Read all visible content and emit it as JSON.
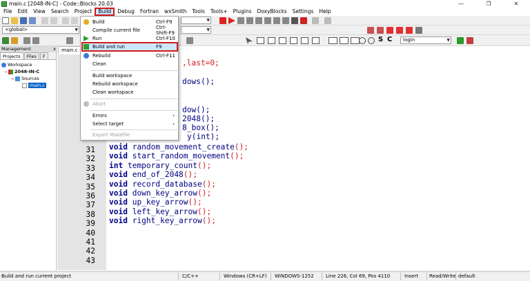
{
  "window": {
    "title": "main.c [2048-IN-C] - Code::Blocks 20.03",
    "minimize": "—",
    "maximize": "❐",
    "close": "✕"
  },
  "menubar": {
    "items": [
      "File",
      "Edit",
      "View",
      "Search",
      "Project",
      "Build",
      "Debug",
      "Fortran",
      "wxSmith",
      "Tools",
      "Tools+",
      "Plugins",
      "DoxyBlocks",
      "Settings",
      "Help"
    ],
    "active": "Build"
  },
  "toolbar": {
    "scope_combo": "<global>",
    "target_combo": "login"
  },
  "build_menu": {
    "items": [
      {
        "label": "Build",
        "shortcut": "Ctrl-F9",
        "icon": "gear-icon"
      },
      {
        "label": "Compile current file",
        "shortcut": "Ctrl-Shift-F9",
        "icon": ""
      },
      {
        "label": "Run",
        "shortcut": "Ctrl-F10",
        "icon": "play-icon"
      },
      {
        "label": "Build and run",
        "shortcut": "F9",
        "icon": "build-run-icon"
      },
      {
        "label": "Rebuild",
        "shortcut": "Ctrl-F11",
        "icon": "rebuild-icon"
      },
      {
        "label": "Clean",
        "shortcut": "",
        "icon": ""
      },
      {
        "label": "Build workspace",
        "shortcut": "",
        "icon": ""
      },
      {
        "label": "Rebuild workspace",
        "shortcut": "",
        "icon": ""
      },
      {
        "label": "Clean workspace",
        "shortcut": "",
        "icon": ""
      },
      {
        "label": "Abort",
        "shortcut": "",
        "icon": "abort-icon"
      },
      {
        "label": "Errors",
        "shortcut": "",
        "icon": ""
      },
      {
        "label": "Select target",
        "shortcut": "",
        "icon": ""
      },
      {
        "label": "Export Makefile",
        "shortcut": "",
        "icon": ""
      }
    ],
    "submenu_arrow": "›"
  },
  "management": {
    "header": "Management",
    "close": "x",
    "tabs": [
      "Projects",
      "Files",
      "F"
    ],
    "tree": {
      "workspace": "Workspace",
      "project": "2048-IN-C",
      "folder": "Sources",
      "file": "main.c"
    }
  },
  "editor": {
    "file_tab": "main.c",
    "visible_fragments": {
      "line_last": ",last=0;",
      "line_dows": "dows();",
      "line_dow": "dow();",
      "line_2048": "2048();",
      "line_8box": "8_box();",
      "line_yint": "y(int);"
    },
    "lines": [
      {
        "n": "31",
        "kw": "void",
        "name": "random_movement_create"
      },
      {
        "n": "32",
        "kw": "void",
        "name": "start_random_movement"
      },
      {
        "n": "33",
        "kw": "int",
        "name": "temporary_count"
      },
      {
        "n": "34",
        "kw": "void",
        "name": "end_of_2048"
      },
      {
        "n": "35",
        "kw": "void",
        "name": "record_database"
      },
      {
        "n": "36",
        "kw": "void",
        "name": "down_key_arrow"
      },
      {
        "n": "37",
        "kw": "void",
        "name": "up_key_arrow"
      },
      {
        "n": "38",
        "kw": "void",
        "name": "left_key_arrow"
      },
      {
        "n": "39",
        "kw": "void",
        "name": "right_key_arrow"
      },
      {
        "n": "40",
        "kw": "",
        "name": ""
      },
      {
        "n": "41",
        "kw": "",
        "name": ""
      },
      {
        "n": "42",
        "kw": "",
        "name": ""
      },
      {
        "n": "43",
        "kw": "",
        "name": ""
      }
    ],
    "paren_close": "();"
  },
  "statusbar": {
    "message": "Build and run current project",
    "language": "C/C++",
    "eol": "Windows (CR+LF)",
    "encoding": "WINDOWS-1252",
    "position": "Line 226, Col 69, Pos 4110",
    "mode": "Insert",
    "access": "Read/Write",
    "profile": "default"
  }
}
